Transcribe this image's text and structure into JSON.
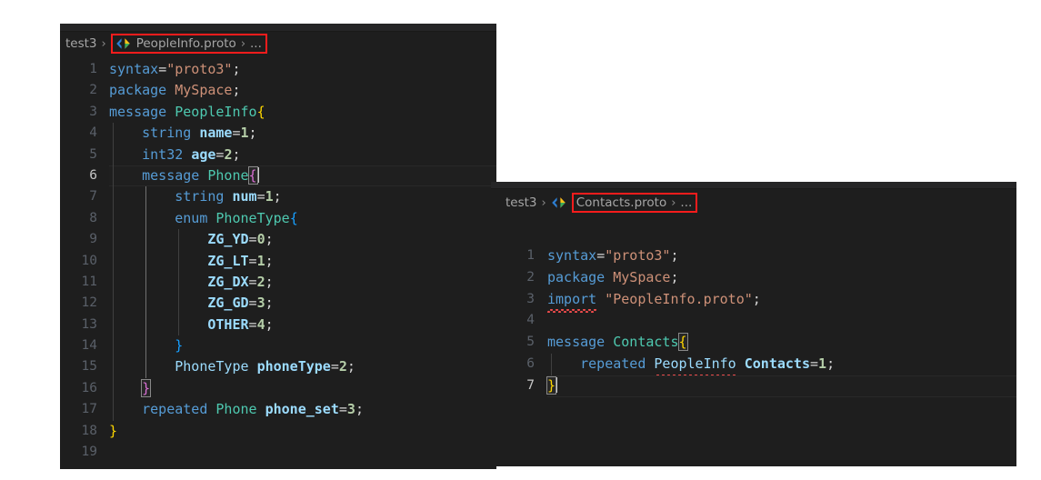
{
  "panels": [
    {
      "id": "peopleinfo",
      "breadcrumb": {
        "root": "test3",
        "separator": "›",
        "file": "PeopleInfo.proto",
        "tail": "...",
        "icon": "proto-file-icon",
        "highlight_color": "#f81c1c"
      },
      "active_line": 6,
      "lines": [
        {
          "n": "1",
          "text": "syntax=\"proto3\";"
        },
        {
          "n": "2",
          "text": "package MySpace;"
        },
        {
          "n": "3",
          "text": "message PeopleInfo{"
        },
        {
          "n": "4",
          "text": "    string name=1;"
        },
        {
          "n": "5",
          "text": "    int32 age=2;"
        },
        {
          "n": "6",
          "text": "    message Phone{"
        },
        {
          "n": "7",
          "text": "        string num=1;"
        },
        {
          "n": "8",
          "text": "        enum PhoneType{"
        },
        {
          "n": "9",
          "text": "            ZG_YD=0;"
        },
        {
          "n": "10",
          "text": "            ZG_LT=1;"
        },
        {
          "n": "11",
          "text": "            ZG_DX=2;"
        },
        {
          "n": "12",
          "text": "            ZG_GD=3;"
        },
        {
          "n": "13",
          "text": "            OTHER=4;"
        },
        {
          "n": "14",
          "text": "        }"
        },
        {
          "n": "15",
          "text": "        PhoneType phoneType=2;"
        },
        {
          "n": "16",
          "text": "    }"
        },
        {
          "n": "17",
          "text": "    repeated Phone phone_set=3;"
        },
        {
          "n": "18",
          "text": "}"
        },
        {
          "n": "19",
          "text": ""
        }
      ]
    },
    {
      "id": "contacts",
      "breadcrumb": {
        "root": "test3",
        "separator": "›",
        "file": "Contacts.proto",
        "tail": "...",
        "icon": "proto-file-icon",
        "highlight_color": "#f81c1c"
      },
      "active_line": 7,
      "lines": [
        {
          "n": "1",
          "text": "syntax=\"proto3\";"
        },
        {
          "n": "2",
          "text": "package MySpace;"
        },
        {
          "n": "3",
          "text": "import \"PeopleInfo.proto\";"
        },
        {
          "n": "4",
          "text": ""
        },
        {
          "n": "5",
          "text": "message Contacts{"
        },
        {
          "n": "6",
          "text": "    repeated PeopleInfo Contacts=1;"
        },
        {
          "n": "7",
          "text": "}"
        }
      ]
    }
  ],
  "theme": {
    "background": "#1e1e1e",
    "gutter_text": "#5a6069",
    "keyword": "#569cd6",
    "type": "#4ec9b0",
    "string": "#ce9178",
    "variable": "#9cdcfe",
    "number": "#b5cea8",
    "punctuation": "#d4d4d4",
    "bracket_yellow": "#ffd700",
    "bracket_magenta": "#da70d6",
    "bracket_blue": "#179fff",
    "error_squiggle": "#f14c4c"
  }
}
